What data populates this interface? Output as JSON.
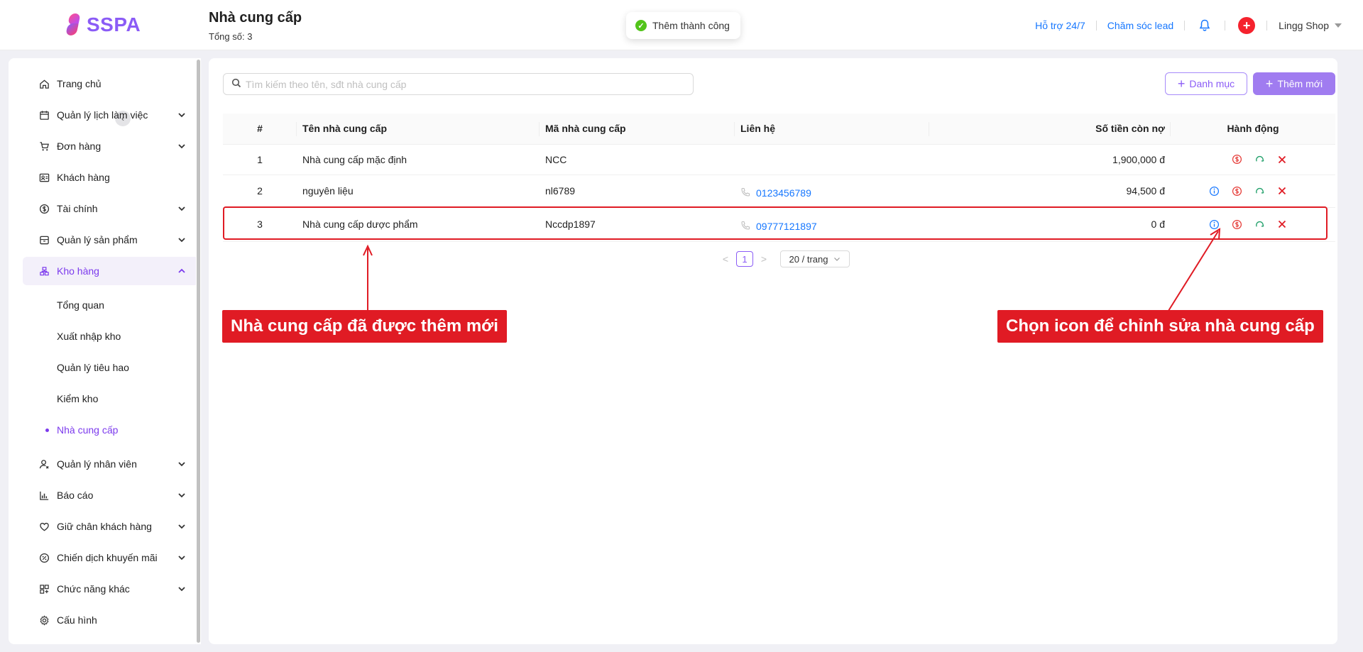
{
  "header": {
    "logo_text": "SSPA",
    "title": "Nhà cung cấp",
    "total": "Tổng số: 3",
    "toast": "Thêm thành công",
    "support_link": "Hỗ trợ 24/7",
    "lead_link": "Chăm sóc lead",
    "add_symbol": "+",
    "shop_name": "Lingg Shop"
  },
  "sidebar": {
    "collapse_symbol": "‹",
    "items": [
      {
        "label": "Trang chủ",
        "icon": "home-icon"
      },
      {
        "label": "Quản lý lịch làm việc",
        "icon": "calendar-icon"
      },
      {
        "label": "Đơn hàng",
        "icon": "cart-icon"
      },
      {
        "label": "Khách hàng",
        "icon": "contacts-icon"
      },
      {
        "label": "Tài chính",
        "icon": "dollar-icon"
      },
      {
        "label": "Quản lý sản phẩm",
        "icon": "box-icon"
      },
      {
        "label": "Kho hàng",
        "icon": "warehouse-icon"
      },
      {
        "label": "Quản lý nhân viên",
        "icon": "user-icon"
      },
      {
        "label": "Báo cáo",
        "icon": "chart-icon"
      },
      {
        "label": "Giữ chân khách hàng",
        "icon": "heart-icon"
      },
      {
        "label": "Chiến dịch khuyến mãi",
        "icon": "percent-icon"
      },
      {
        "label": "Chức năng khác",
        "icon": "apps-icon"
      },
      {
        "label": "Cấu hình",
        "icon": "gear-icon"
      }
    ],
    "sub_items": [
      "Tổng quan",
      "Xuất nhập kho",
      "Quản lý tiêu hao",
      "Kiểm kho",
      "Nhà cung cấp"
    ]
  },
  "toolbar": {
    "search_placeholder": "Tìm kiếm theo tên, sđt nhà cung cấp",
    "category_label": "Danh mục",
    "add_label": "Thêm mới"
  },
  "table": {
    "headers": [
      "#",
      "Tên nhà cung cấp",
      "Mã nhà cung cấp",
      "Liên hệ",
      "Số tiền còn nợ",
      "Hành động"
    ],
    "rows": [
      {
        "num": "1",
        "name": "Nhà cung cấp mặc định",
        "code": "NCC",
        "phone": "",
        "debt": "1,900,000 đ"
      },
      {
        "num": "2",
        "name": "nguyên liệu",
        "code": "nl6789",
        "phone": "0123456789",
        "debt": "94,500 đ"
      },
      {
        "num": "3",
        "name": "Nhà cung cấp dược phẩm",
        "code": "Nccdp1897",
        "phone": "09777121897",
        "debt": "0 đ"
      }
    ]
  },
  "pagination": {
    "prev": "<",
    "current": "1",
    "next": ">",
    "page_size": "20 / trang"
  },
  "annotations": {
    "left_callout": "Nhà cung cấp đã được thêm mới",
    "right_callout": "Chọn icon để chỉnh sửa nhà cung cấp"
  },
  "colors": {
    "brand": "#8b5cf6",
    "link": "#1677ff",
    "annotation": "#e01b24",
    "success": "#52c41a"
  }
}
